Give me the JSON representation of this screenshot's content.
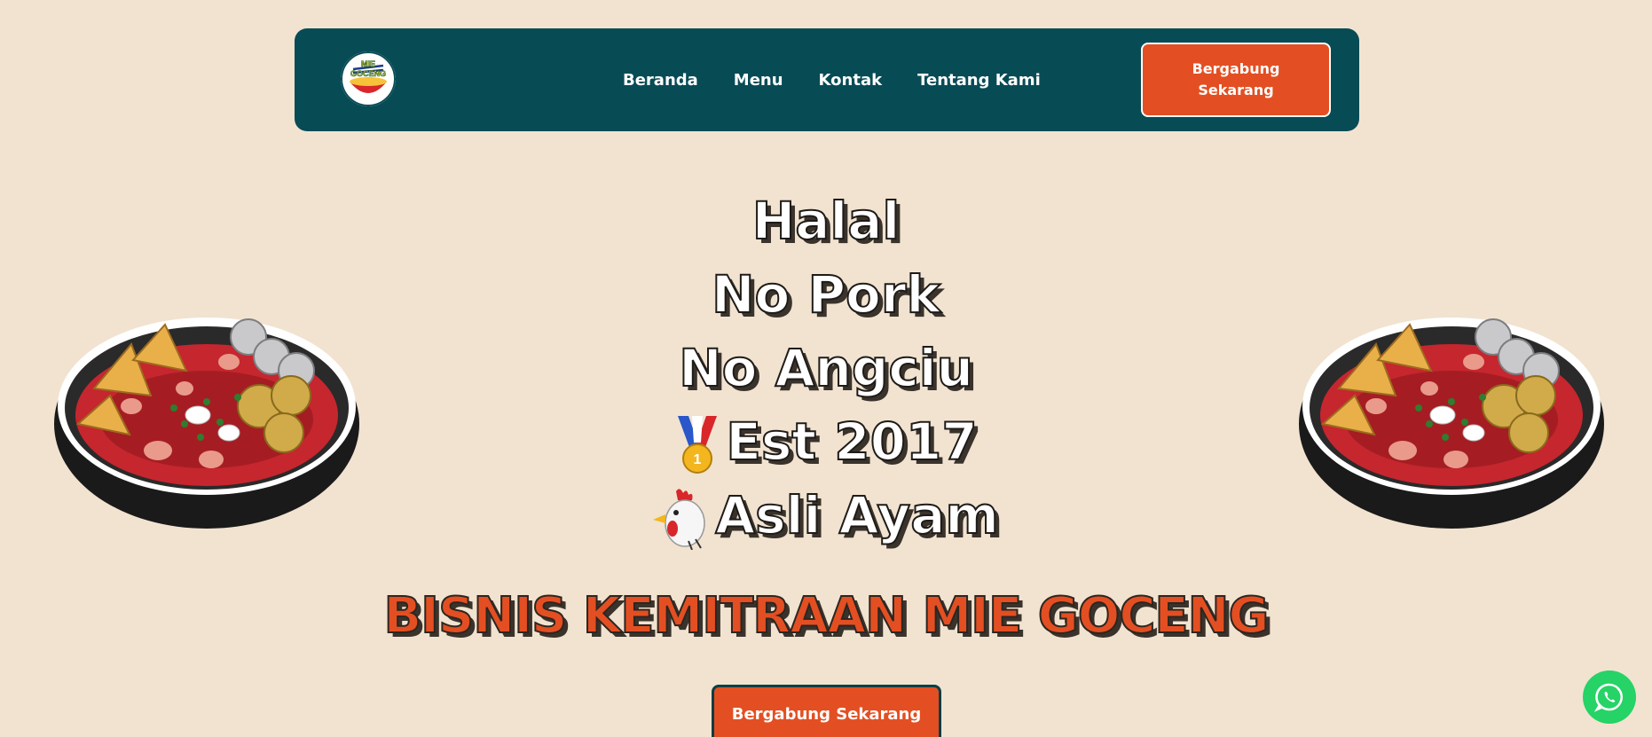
{
  "navbar": {
    "logo_text": "MIE GOCENG",
    "links": [
      {
        "label": "Beranda"
      },
      {
        "label": "Menu"
      },
      {
        "label": "Kontak"
      },
      {
        "label": "Tentang Kami"
      }
    ],
    "cta_label": "Bergabung Sekarang"
  },
  "hero": {
    "lines": [
      {
        "text": "Halal",
        "icon": ""
      },
      {
        "text": "No Pork",
        "icon": ""
      },
      {
        "text": "No Angciu",
        "icon": ""
      },
      {
        "text": "Est 2017",
        "icon": "medal-icon"
      },
      {
        "text": "Asli Ayam",
        "icon": "rooster-icon"
      }
    ],
    "title": "BISNIS KEMITRAAN MIE GOCENG",
    "cta_label": "Bergabung Sekarang"
  },
  "floating": {
    "whatsapp_icon": "whatsapp-icon"
  },
  "colors": {
    "background": "#f1e3d0",
    "navbar": "#074b55",
    "accent": "#e34f22",
    "whatsapp": "#25d366"
  }
}
